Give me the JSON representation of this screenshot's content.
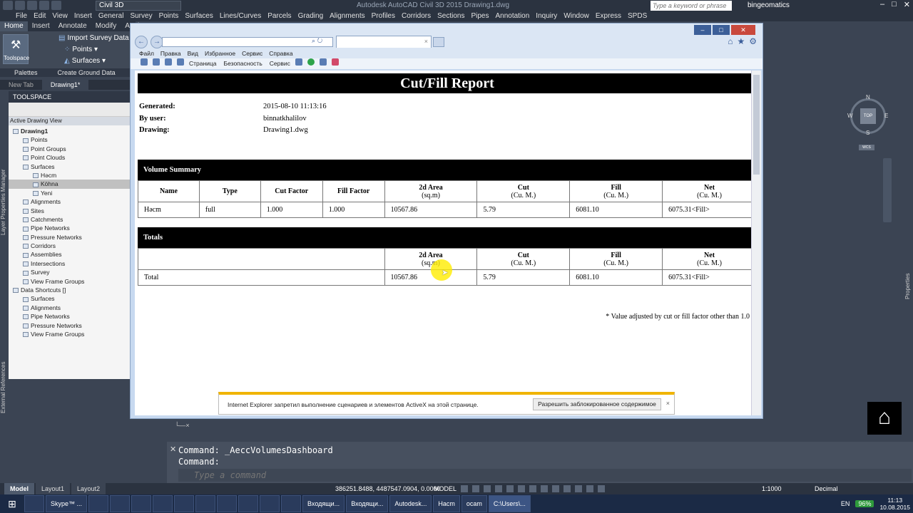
{
  "acad": {
    "workspace": "Civil 3D",
    "title": "Autodesk AutoCAD Civil 3D 2015    Drawing1.dwg",
    "search_placeholder": "Type a keyword or phrase",
    "user": "bingeomatics",
    "menu": [
      "File",
      "Edit",
      "View",
      "Insert",
      "General",
      "Survey",
      "Points",
      "Surfaces",
      "Lines/Curves",
      "Parcels",
      "Grading",
      "Alignments",
      "Profiles",
      "Corridors",
      "Sections",
      "Pipes",
      "Annotation",
      "Inquiry",
      "Window",
      "Express",
      "SPDS"
    ],
    "ribbon_tabs": [
      "Home",
      "Insert",
      "Annotate",
      "Modify",
      "Analy"
    ],
    "ribbon_items": {
      "import": "Import Survey Data",
      "points": "Points",
      "surfaces": "Surfaces",
      "toolspace": "Toolspace"
    },
    "ribbon_panels": [
      "Palettes",
      "Create Ground Data"
    ],
    "doc_tabs": [
      "New Tab",
      "Drawing1*"
    ],
    "toolspace": {
      "header": "TOOLSPACE",
      "view": "Active Drawing View",
      "tree": [
        {
          "label": "Drawing1",
          "level": 0,
          "bold": true
        },
        {
          "label": "Points",
          "level": 1
        },
        {
          "label": "Point Groups",
          "level": 1
        },
        {
          "label": "Point Clouds",
          "level": 1
        },
        {
          "label": "Surfaces",
          "level": 1
        },
        {
          "label": "Həcm",
          "level": 2
        },
        {
          "label": "Köhna",
          "level": 2,
          "selected": true
        },
        {
          "label": "Yeni",
          "level": 2
        },
        {
          "label": "Alignments",
          "level": 1
        },
        {
          "label": "Sites",
          "level": 1
        },
        {
          "label": "Catchments",
          "level": 1
        },
        {
          "label": "Pipe Networks",
          "level": 1
        },
        {
          "label": "Pressure Networks",
          "level": 1
        },
        {
          "label": "Corridors",
          "level": 1
        },
        {
          "label": "Assemblies",
          "level": 1
        },
        {
          "label": "Intersections",
          "level": 1
        },
        {
          "label": "Survey",
          "level": 1
        },
        {
          "label": "View Frame Groups",
          "level": 1
        },
        {
          "label": "Data Shortcuts []",
          "level": 0
        },
        {
          "label": "Surfaces",
          "level": 1
        },
        {
          "label": "Alignments",
          "level": 1
        },
        {
          "label": "Pipe Networks",
          "level": 1
        },
        {
          "label": "Pressure Networks",
          "level": 1
        },
        {
          "label": "View Frame Groups",
          "level": 1
        }
      ]
    },
    "side_tabs": {
      "left": "Layer Properties Manager",
      "left2": "External References",
      "right": "Properties"
    },
    "viewcube": {
      "n": "N",
      "s": "S",
      "e": "E",
      "w": "W",
      "top": "TOP",
      "wcs": "WCS"
    },
    "command_history": [
      "Command: _AeccVolumesDashboard",
      "Command:"
    ],
    "command_placeholder": "Type a command",
    "layout_tabs": [
      "Model",
      "Layout1",
      "Layout2"
    ],
    "coords": "386251.8488, 4487547.0904, 0.0000",
    "model_label": "MODEL",
    "scale": "1:1000",
    "units": "Decimal"
  },
  "taskbar": {
    "apps": [
      "",
      "Skype™ ...",
      "",
      "",
      "",
      "",
      "",
      "",
      "",
      "",
      "",
      "",
      "Входящи...",
      "Входящи...",
      "Autodesk...",
      "Насm",
      "ocam",
      "C:\\Users\\..."
    ],
    "lang": "EN",
    "battery": "96%",
    "time": "11:13",
    "date": "10.08.2015"
  },
  "ie": {
    "address": "",
    "tab_title": "",
    "menu": [
      "Файл",
      "Правка",
      "Вид",
      "Избранное",
      "Сервис",
      "Справка"
    ],
    "cmdbar": [
      "Страница",
      "Безопасность",
      "Сервис"
    ],
    "notification": {
      "text": "Internet Explorer запретил выполнение сценариев и элементов ActiveX на этой странице.",
      "button": "Разрешить заблокированное содержимое",
      "close": "×"
    }
  },
  "report": {
    "title": "Cut/Fill Report",
    "meta": [
      {
        "label": "Generated:",
        "value": "2015-08-10 11:13:16"
      },
      {
        "label": "By user:",
        "value": "binnatkhalilov"
      },
      {
        "label": "Drawing:",
        "value": "Drawing1.dwg"
      }
    ],
    "volume_summary": {
      "title": "Volume Summary",
      "headers": [
        {
          "main": "Name",
          "sub": ""
        },
        {
          "main": "Type",
          "sub": ""
        },
        {
          "main": "Cut Factor",
          "sub": ""
        },
        {
          "main": "Fill Factor",
          "sub": ""
        },
        {
          "main": "2d Area",
          "sub": "(sq.m)"
        },
        {
          "main": "Cut",
          "sub": "(Cu. M.)"
        },
        {
          "main": "Fill",
          "sub": "(Cu. M.)"
        },
        {
          "main": "Net",
          "sub": "(Cu. M.)"
        }
      ],
      "rows": [
        [
          "Həcm",
          "full",
          "1.000",
          "1.000",
          "10567.86",
          "5.79",
          "6081.10",
          "6075.31<Fill>"
        ]
      ]
    },
    "totals": {
      "title": "Totals",
      "headers": [
        {
          "main": "",
          "sub": ""
        },
        {
          "main": "2d Area",
          "sub": "(sq.m)"
        },
        {
          "main": "Cut",
          "sub": "(Cu. M.)"
        },
        {
          "main": "Fill",
          "sub": "(Cu. M.)"
        },
        {
          "main": "Net",
          "sub": "(Cu. M.)"
        }
      ],
      "rows": [
        [
          "Total",
          "10567.86",
          "5.79",
          "6081.10",
          "6075.31<Fill>"
        ]
      ]
    },
    "footnote": "* Value adjusted by cut or fill factor other than 1.0"
  }
}
